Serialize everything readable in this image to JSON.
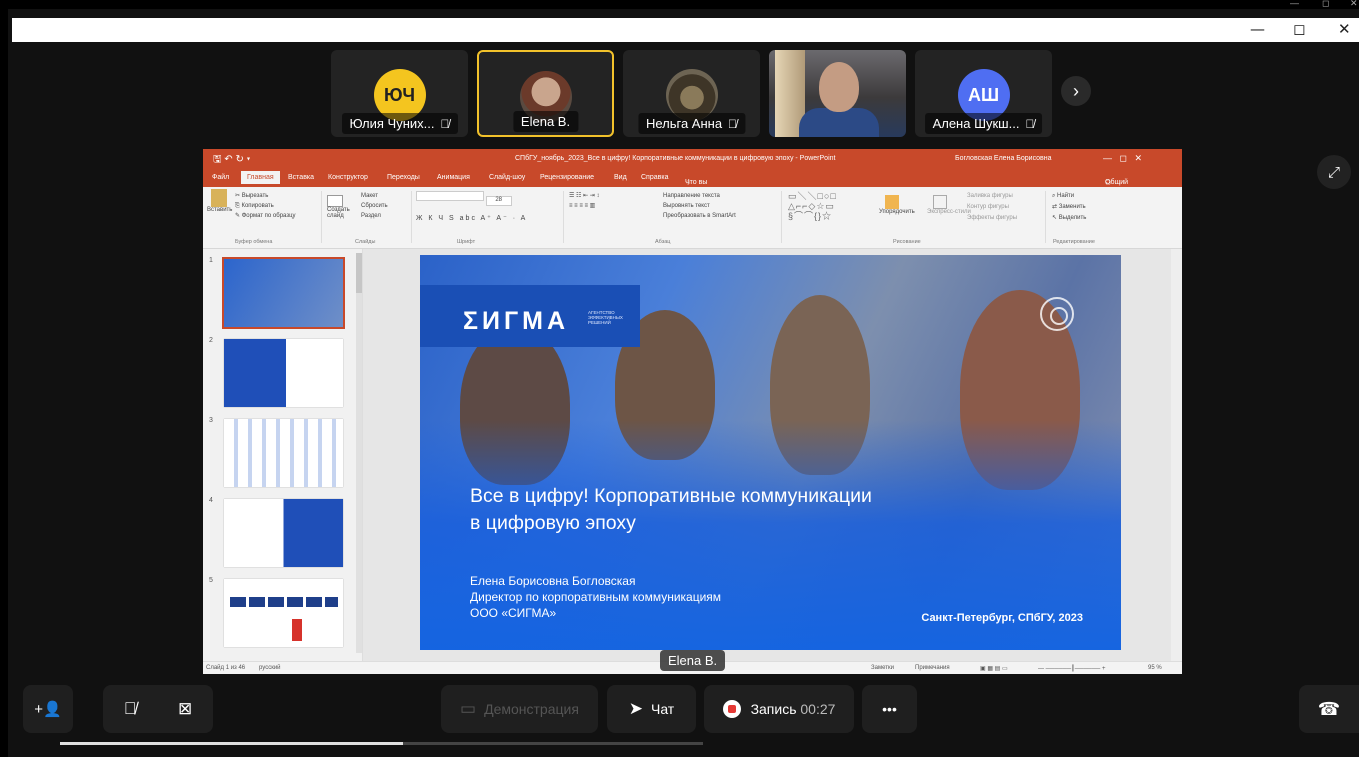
{
  "window": {
    "minimize": "—",
    "restore": "◻",
    "close": "✕"
  },
  "participants": [
    {
      "initials": "ЮЧ",
      "name": "Юлия Чуних...",
      "muted": true,
      "color": "#f4c51f"
    },
    {
      "initials": "",
      "name": "Elena B.",
      "muted": false,
      "active": true
    },
    {
      "initials": "",
      "name": "Нельга Анна",
      "muted": true
    },
    {
      "initials": "",
      "name": "",
      "muted": false,
      "video": true
    },
    {
      "initials": "АШ",
      "name": "Алена Шукш...",
      "muted": true,
      "color": "#4f6ef2"
    }
  ],
  "powerpoint": {
    "title": "СПбГУ_ноябрь_2023_Все в цифру! Корпоративные коммуникации в цифровую эпоху - PowerPoint",
    "user": "Богловская Елена Борисовна",
    "tabs": [
      "Файл",
      "Главная",
      "Вставка",
      "Конструктор",
      "Переходы",
      "Анимация",
      "Слайд-шоу",
      "Рецензирование",
      "Вид",
      "Справка",
      "Что вы хотите сделать?"
    ],
    "share_label": "Общий доступ",
    "ribbon": {
      "paste": "Вставить",
      "cut": "Вырезать",
      "copy": "Копировать",
      "format_painter": "Формат по образцу",
      "clipboard": "Буфер обмена",
      "new_slide": "Создать слайд",
      "layout": "Макет",
      "reset": "Сбросить",
      "section": "Раздел",
      "slides": "Слайды",
      "font": "Шрифт",
      "font_size": "28",
      "text_direction": "Направление текста",
      "align_text": "Выровнять текст",
      "smartart": "Преобразовать в SmartArt",
      "paragraph": "Абзац",
      "arrange": "Упорядочить",
      "quick_styles": "Экспресс-стили",
      "shape_fill": "Заливка фигуры",
      "shape_outline": "Контур фигуры",
      "shape_effects": "Эффекты фигуры",
      "drawing": "Рисование",
      "find": "Найти",
      "replace": "Заменить",
      "select": "Выделить",
      "editing": "Редактирование"
    },
    "thumbnails": [
      "1",
      "2",
      "3",
      "4",
      "5"
    ],
    "status": {
      "slide": "Слайд 1 из 46",
      "lang": "русский",
      "notes": "Заметки",
      "comments": "Примечания",
      "zoom": "95 %"
    }
  },
  "slide": {
    "logo": "ƩИГМА",
    "logo_sub": "АГЕНТСТВО ЭФФЕКТИВНЫХ РЕШЕНИЙ",
    "title_line1": "Все в цифру! Корпоративные коммуникации",
    "title_line2": "в цифровую эпоху",
    "author": "Елена Борисовна Богловская",
    "position": "Директор по корпоративным коммуникациям",
    "company": "ООО «СИГМА»",
    "city": "Санкт-Петербург, СПбГУ, 2023"
  },
  "presenter_label": "Elena B.",
  "controls": {
    "demo": "Демонстрация",
    "chat": "Чат",
    "record": "Запись",
    "record_time": "00:27",
    "more": "•••"
  }
}
